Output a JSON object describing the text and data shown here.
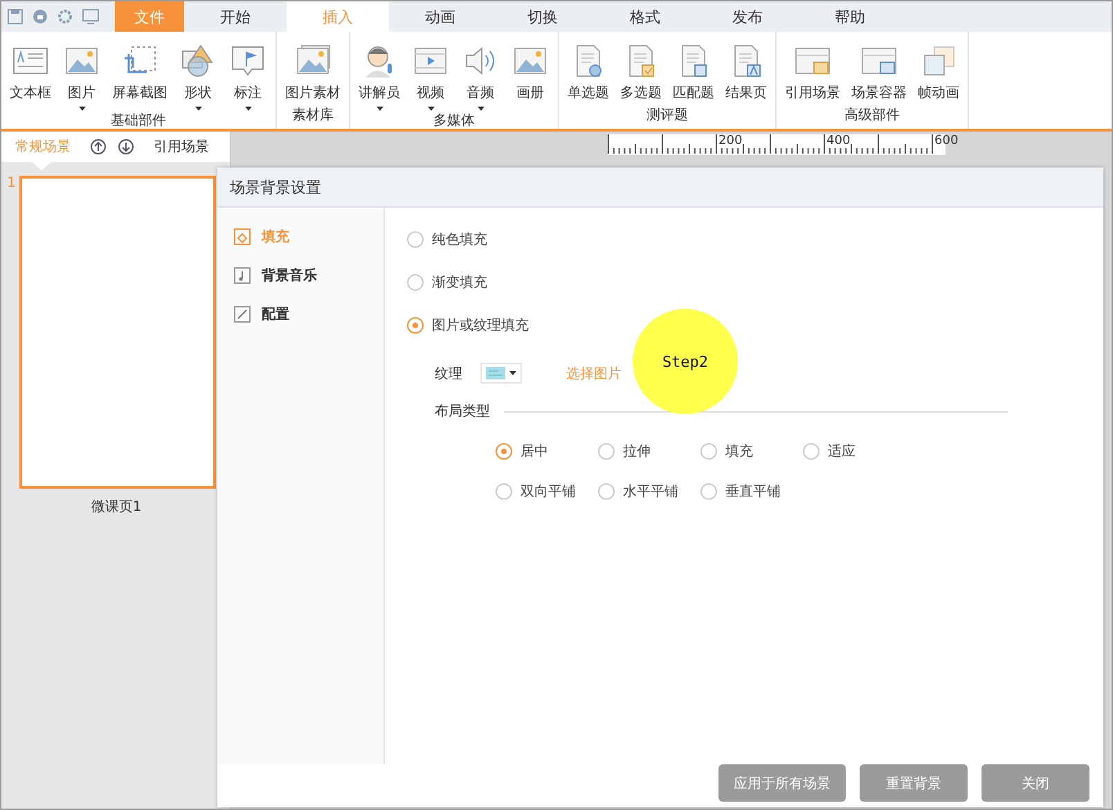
{
  "menu_tabs": [
    {
      "label": "文件",
      "kind": "file",
      "selected": false
    },
    {
      "label": "开始",
      "kind": "tab",
      "selected": false
    },
    {
      "label": "插入",
      "kind": "tab",
      "selected": true
    },
    {
      "label": "动画",
      "kind": "tab",
      "selected": false
    },
    {
      "label": "切换",
      "kind": "tab",
      "selected": false
    },
    {
      "label": "格式",
      "kind": "tab",
      "selected": false
    },
    {
      "label": "发布",
      "kind": "tab",
      "selected": false
    },
    {
      "label": "帮助",
      "kind": "tab",
      "selected": false
    }
  ],
  "ribbon_groups": [
    {
      "label": "基础部件",
      "items": [
        {
          "label": "文本框",
          "kind": "textbox",
          "dropdown": false
        },
        {
          "label": "图片",
          "kind": "image",
          "dropdown": true
        },
        {
          "label": "屏幕截图",
          "kind": "crop",
          "dropdown": false
        },
        {
          "label": "形状",
          "kind": "shape",
          "dropdown": true
        },
        {
          "label": "标注",
          "kind": "callout",
          "dropdown": true
        }
      ]
    },
    {
      "label": "素材库",
      "items": [
        {
          "label": "图片素材",
          "kind": "stack",
          "dropdown": false
        }
      ]
    },
    {
      "label": "多媒体",
      "items": [
        {
          "label": "讲解员",
          "kind": "person",
          "dropdown": true
        },
        {
          "label": "视频",
          "kind": "video",
          "dropdown": true
        },
        {
          "label": "音频",
          "kind": "audio",
          "dropdown": true
        },
        {
          "label": "画册",
          "kind": "image",
          "dropdown": false
        }
      ]
    },
    {
      "label": "测评题",
      "items": [
        {
          "label": "单选题",
          "kind": "single",
          "dropdown": false
        },
        {
          "label": "多选题",
          "kind": "multi",
          "dropdown": false
        },
        {
          "label": "匹配题",
          "kind": "match",
          "dropdown": false
        },
        {
          "label": "结果页",
          "kind": "result",
          "dropdown": false
        }
      ]
    },
    {
      "label": "高级部件",
      "items": [
        {
          "label": "引用场景",
          "kind": "ref",
          "dropdown": false
        },
        {
          "label": "场景容器",
          "kind": "container",
          "dropdown": false
        },
        {
          "label": "帧动画",
          "kind": "frames",
          "dropdown": false
        }
      ]
    }
  ],
  "scene_panel": {
    "tabs": [
      {
        "label": "常规场景",
        "selected": true
      },
      {
        "label": "引用场景",
        "selected": false
      }
    ],
    "pages": [
      {
        "number": "1",
        "caption": "微课页1",
        "selected": true
      }
    ]
  },
  "ruler": {
    "labels": [
      "200",
      "400",
      "600"
    ]
  },
  "dialog": {
    "title": "场景背景设置",
    "nav": [
      {
        "label": "填充",
        "kind": "fill",
        "selected": true
      },
      {
        "label": "背景音乐",
        "kind": "music",
        "selected": false
      },
      {
        "label": "配置",
        "kind": "config",
        "selected": false
      }
    ],
    "fill_options": [
      {
        "label": "纯色填充",
        "selected": false
      },
      {
        "label": "渐变填充",
        "selected": false
      },
      {
        "label": "图片或纹理填充",
        "selected": true
      }
    ],
    "texture": {
      "label": "纹理",
      "link": "选择图片"
    },
    "layout": {
      "title": "布局类型",
      "options": [
        {
          "label": "居中",
          "selected": true
        },
        {
          "label": "拉伸",
          "selected": false
        },
        {
          "label": "填充",
          "selected": false
        },
        {
          "label": "适应",
          "selected": false
        },
        {
          "label": "双向平铺",
          "selected": false
        },
        {
          "label": "水平平铺",
          "selected": false
        },
        {
          "label": "垂直平铺",
          "selected": false
        }
      ]
    },
    "buttons": [
      "应用于所有场景",
      "重置背景",
      "关闭"
    ]
  },
  "annotation": {
    "text": "Step2"
  }
}
